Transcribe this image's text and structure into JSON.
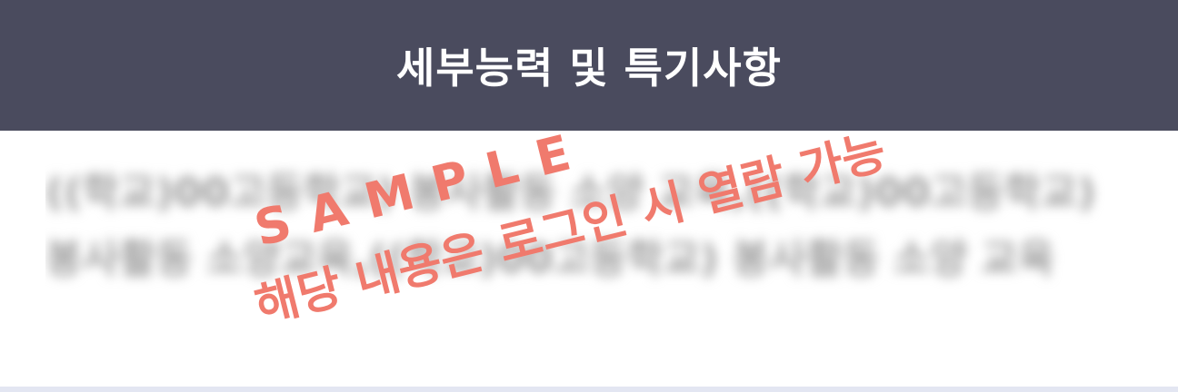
{
  "header": {
    "title": "세부능력 및 특기사항"
  },
  "content": {
    "text": "((학교)00고등학교) 봉사활동 소양 교육,((학교)00고등학교) 봉사활동 소양교육,((학교)00고등학교) 봉사활동 소양 교육"
  },
  "watermark": {
    "sample": "SAMPLE",
    "notice": "해당 내용은 로그인 시 열람 가능"
  },
  "colors": {
    "header_bg": "#4a4b5e",
    "watermark": "#f07a6d",
    "divider": "#e3e6f2"
  }
}
